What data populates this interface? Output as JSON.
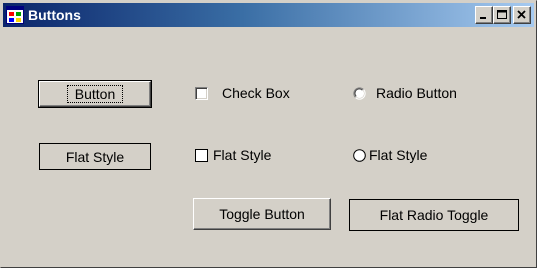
{
  "window": {
    "title": "Buttons",
    "icon": "windows-form-icon",
    "caption_buttons": [
      "minimize-icon",
      "maximize-icon",
      "close-icon"
    ]
  },
  "controls": {
    "button": {
      "label": "Button",
      "style": "3d",
      "is_default": true,
      "focused": true
    },
    "flat_button": {
      "label": "Flat Style",
      "style": "flat"
    },
    "check_box": {
      "label": "Check Box",
      "checked": false,
      "style": "3d"
    },
    "flat_check_box": {
      "label": "Flat Style",
      "checked": false,
      "style": "flat"
    },
    "toggle_button": {
      "label": "Toggle Button",
      "style": "3d",
      "pressed": false
    },
    "radio_button": {
      "label": "Radio Button",
      "checked": false,
      "style": "3d"
    },
    "flat_radio": {
      "label": "Flat Style",
      "checked": false,
      "style": "flat"
    },
    "flat_radio_toggle": {
      "label": "Flat Radio Toggle",
      "style": "flat",
      "pressed": false
    }
  },
  "colors": {
    "face": "#d4d0c8",
    "titlebar_start": "#0a246a",
    "titlebar_end": "#a6caf0",
    "title_text": "#ffffff"
  }
}
